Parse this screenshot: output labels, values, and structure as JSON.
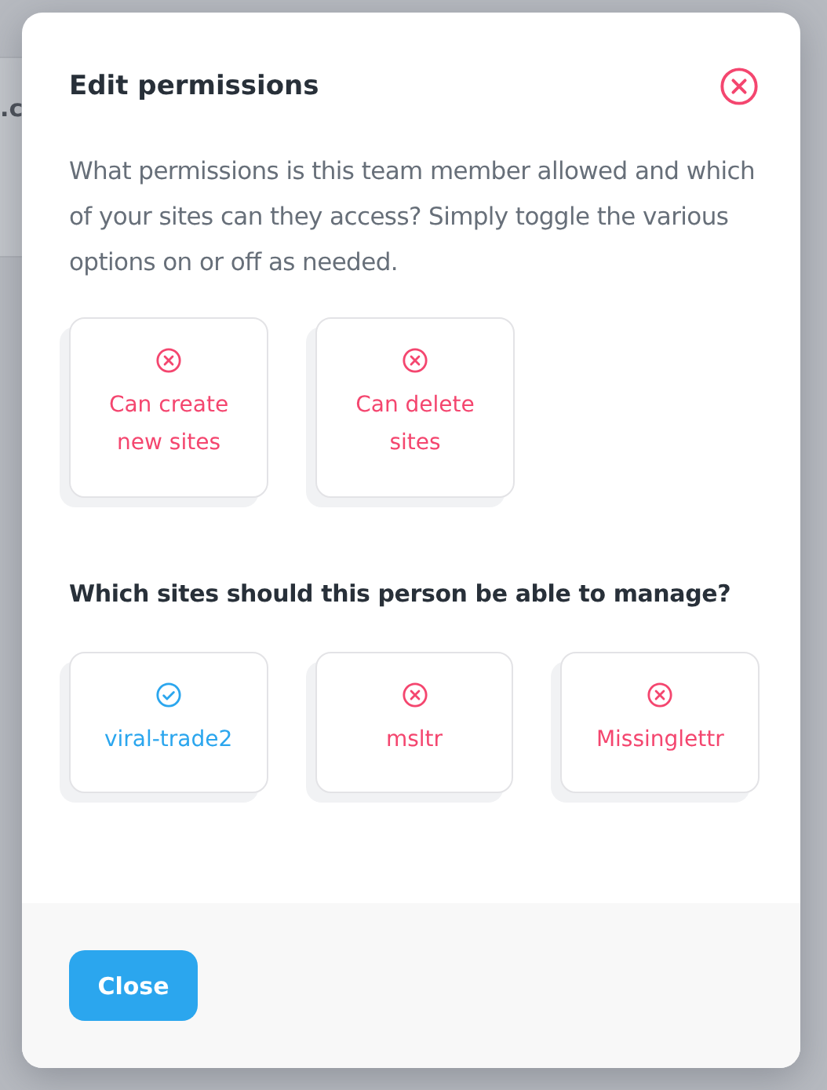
{
  "background": {
    "text": ".c"
  },
  "dialog": {
    "title": "Edit permissions",
    "description": "What permissions is this team member allowed and which of your sites can they access? Simply toggle the various options on or off as needed.",
    "permissions": [
      {
        "label": "Can create new sites",
        "allowed": false
      },
      {
        "label": "Can delete sites",
        "allowed": false
      }
    ],
    "sites_heading": "Which sites should this person be able to manage?",
    "sites": [
      {
        "label": "viral-trade2",
        "allowed": true
      },
      {
        "label": "msltr",
        "allowed": false
      },
      {
        "label": "Missinglettr",
        "allowed": false
      }
    ],
    "buttons": [
      "Close"
    ]
  }
}
